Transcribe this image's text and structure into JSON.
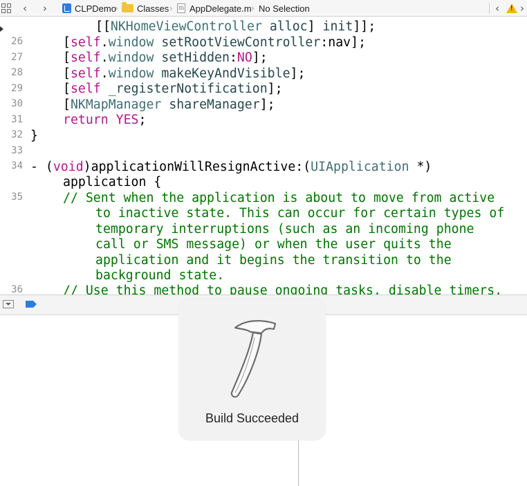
{
  "jumpbar": {
    "project": "CLPDemo",
    "folder": "Classes",
    "file": "AppDelegate.m",
    "file_icon_letter": "m",
    "selection": "No Selection"
  },
  "editor": {
    "line_numbers": [
      "26",
      "27",
      "28",
      "29",
      "30",
      "31",
      "32",
      "33",
      "34",
      "35",
      "36"
    ]
  },
  "hud": {
    "message": "Build Succeeded",
    "icon": "hammer-icon"
  },
  "colors": {
    "keyword": "#b21889",
    "class": "#3f6e74",
    "comment": "#007400",
    "accent": "#2b7de1",
    "warning": "#f2b705"
  }
}
